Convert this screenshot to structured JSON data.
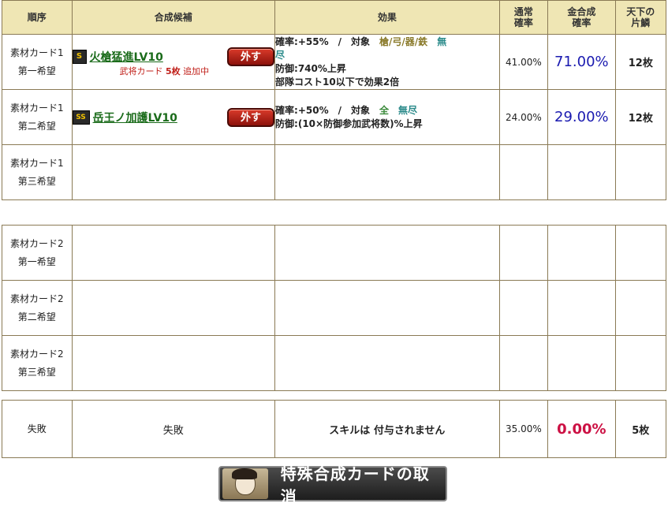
{
  "header": {
    "order": "順序",
    "candidate": "合成候補",
    "effect": "効果",
    "normal_rate_line1": "通常",
    "normal_rate_line2": "確率",
    "gold_rate_line1": "金合成",
    "gold_rate_line2": "確率",
    "fragments_line1": "天下の",
    "fragments_line2": "片鱗"
  },
  "card1": {
    "rows": [
      {
        "order_line1": "素材カード1",
        "order_line2": "第一希望",
        "rank": "S",
        "skill_name": "火槍猛進LV10",
        "remove_label": "外す",
        "added_prefix": "武将カード",
        "added_count": "5枚",
        "added_suffix": "追加中",
        "effect_rate": "確率:+55%　/　対象",
        "effect_targets": "槍/弓/器/鉄",
        "effect_targets2": "無",
        "effect_targets3": "尽",
        "effect_line2": "防御:740%上昇",
        "effect_line3": "部隊コスト10以下で効果2倍",
        "normal_rate": "41.00%",
        "gold_rate": "71.00%",
        "fragments": "12枚"
      },
      {
        "order_line1": "素材カード1",
        "order_line2": "第二希望",
        "rank": "SS",
        "skill_name": "岳王ノ加護LV10",
        "remove_label": "外す",
        "effect_rate": "確率:+50%　/　対象",
        "effect_targets": "全",
        "effect_targets2": "無尽",
        "effect_line2": "防御:(10×防御参加武将数)%上昇",
        "normal_rate": "24.00%",
        "gold_rate": "29.00%",
        "fragments": "12枚"
      },
      {
        "order_line1": "素材カード1",
        "order_line2": "第三希望"
      }
    ]
  },
  "card2": {
    "rows": [
      {
        "order_line1": "素材カード2",
        "order_line2": "第一希望"
      },
      {
        "order_line1": "素材カード2",
        "order_line2": "第二希望"
      },
      {
        "order_line1": "素材カード2",
        "order_line2": "第三希望"
      }
    ]
  },
  "fail": {
    "order": "失敗",
    "candidate": "失敗",
    "effect": "スキルは 付与されません",
    "normal_rate": "35.00%",
    "gold_rate": "0.00%",
    "fragments": "5枚"
  },
  "cancel_button": {
    "label": "特殊合成カードの取消",
    "icon": "general-portrait-icon"
  }
}
